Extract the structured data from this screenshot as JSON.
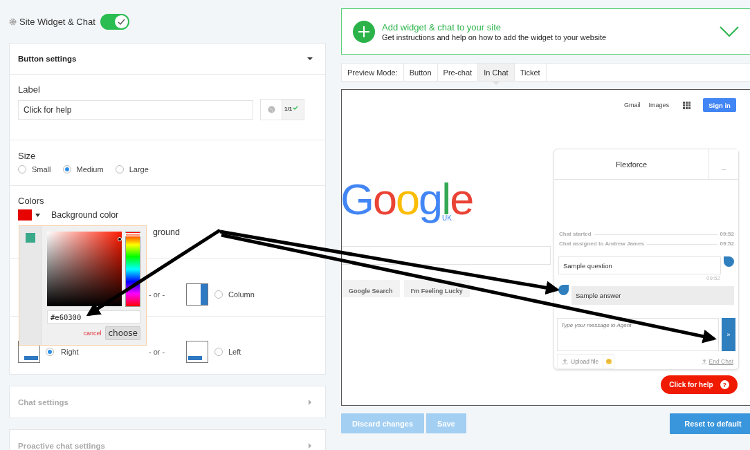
{
  "header": {
    "title": "Site Widget & Chat",
    "enabled": true
  },
  "button_settings": {
    "title": "Button settings",
    "expanded": true,
    "label": {
      "heading": "Label",
      "value": "Click for help",
      "counter": "1/1"
    },
    "size": {
      "heading": "Size",
      "options": [
        {
          "label": "Small",
          "selected": false
        },
        {
          "label": "Medium",
          "selected": true
        },
        {
          "label": "Large",
          "selected": false
        }
      ]
    },
    "colors": {
      "heading": "Colors",
      "background_label": "Background color",
      "text_label_visible": "ground"
    },
    "layout": {
      "separator": "- or -",
      "option": {
        "label": "Column",
        "selected": false
      }
    },
    "position": {
      "separator": "- or -",
      "options": [
        {
          "label": "Right",
          "selected": true
        },
        {
          "label": "Left",
          "selected": false
        }
      ]
    }
  },
  "color_picker": {
    "recent_colors": [
      {
        "color": "#3aa98a"
      }
    ],
    "hex": "#e60300",
    "hue": {
      "level": 0.02
    },
    "cancel": "cancel",
    "choose": "choose"
  },
  "collapsed_sections": [
    {
      "title": "Chat settings",
      "expanded": false
    },
    {
      "title": "Proactive chat settings",
      "expanded": false
    }
  ],
  "install_banner": {
    "title": "Add widget & chat to your site",
    "subtitle": "Get instructions and help on how to add the widget to your website"
  },
  "preview_mode": {
    "label": "Preview Mode:",
    "tabs": [
      {
        "label": "Button",
        "selected": false
      },
      {
        "label": "Pre-chat",
        "selected": false
      },
      {
        "label": "In Chat",
        "selected": true
      },
      {
        "label": "Ticket",
        "selected": false
      }
    ]
  },
  "preview": {
    "links": [
      "Gmail",
      "Images"
    ],
    "sign_in": "Sign in",
    "logo": "Google",
    "logo_region": "UK",
    "search_buttons": [
      "Google Search",
      "I'm Feeling Lucky"
    ],
    "chat": {
      "title": "Flexforce",
      "minimize": "_",
      "events": [
        {
          "text": "Chat started",
          "time": "09:52"
        },
        {
          "text": "Chat assigned to Andrew James",
          "time": "09:52"
        }
      ],
      "messages": [
        {
          "kind": "visitor",
          "text": "Sample question",
          "time": "09:52"
        },
        {
          "kind": "agent",
          "text": "Sample answer"
        }
      ],
      "input_placeholder": "Type your message to Agent",
      "send": "»",
      "upload": "Upload file",
      "end_chat": "End Chat"
    },
    "launcher": {
      "label": "Click for help",
      "icon": "?"
    }
  },
  "actions": [
    {
      "kind": "discard",
      "label": "Discard changes",
      "disabled": true
    },
    {
      "kind": "save",
      "label": "Save",
      "disabled": true
    },
    {
      "kind": "reset",
      "label": "Reset to default",
      "disabled": false
    }
  ]
}
